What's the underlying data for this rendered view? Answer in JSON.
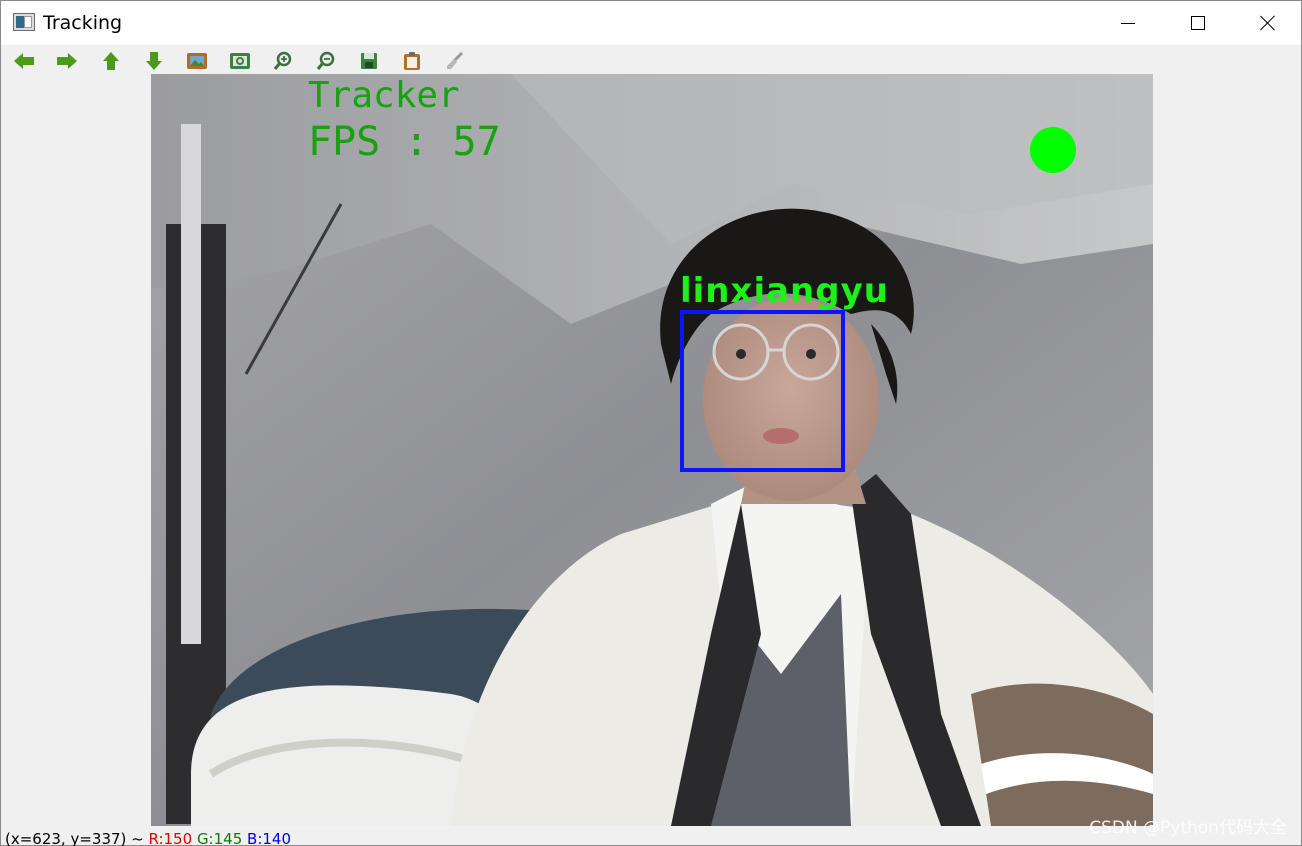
{
  "window": {
    "title": "Tracking",
    "app_icon": "opencv-window-icon",
    "controls": [
      "minimize-icon",
      "maximize-icon",
      "close-icon"
    ]
  },
  "toolbar": {
    "buttons": [
      {
        "icon": "arrow-left-icon",
        "color": "#4b9a1c"
      },
      {
        "icon": "arrow-right-icon",
        "color": "#4b9a1c"
      },
      {
        "icon": "arrow-up-icon",
        "color": "#4b9a1c"
      },
      {
        "icon": "arrow-down-icon",
        "color": "#4b9a1c"
      },
      {
        "icon": "image-icon",
        "color": "#b26b2a"
      },
      {
        "icon": "zoom-fit-icon",
        "color": "#3f7f3f"
      },
      {
        "icon": "zoom-in-icon",
        "color": "#3f7f3f"
      },
      {
        "icon": "zoom-out-icon",
        "color": "#3f7f3f"
      },
      {
        "icon": "save-icon",
        "color": "#3f7f3f"
      },
      {
        "icon": "clipboard-icon",
        "color": "#b0702a"
      },
      {
        "icon": "brush-icon",
        "color": "#8a8a8a"
      }
    ]
  },
  "frame": {
    "tracker_text": "Tracker",
    "fps_text": "FPS : 57",
    "person_name": "linxiangyu",
    "box_color": "#0a14ff",
    "label_color": "#1df01a",
    "overlay_text_color": "#17a30f",
    "indicator_color": "#00ff00"
  },
  "status": {
    "prefix": "(x=623, y=337) ~ ",
    "r": "R:150",
    "g": "G:145",
    "b": "B:140",
    "r_color": "#e00000",
    "g_color": "#008000",
    "b_color": "#0000e0",
    "watermark": "CSDN @Python代码大全"
  }
}
